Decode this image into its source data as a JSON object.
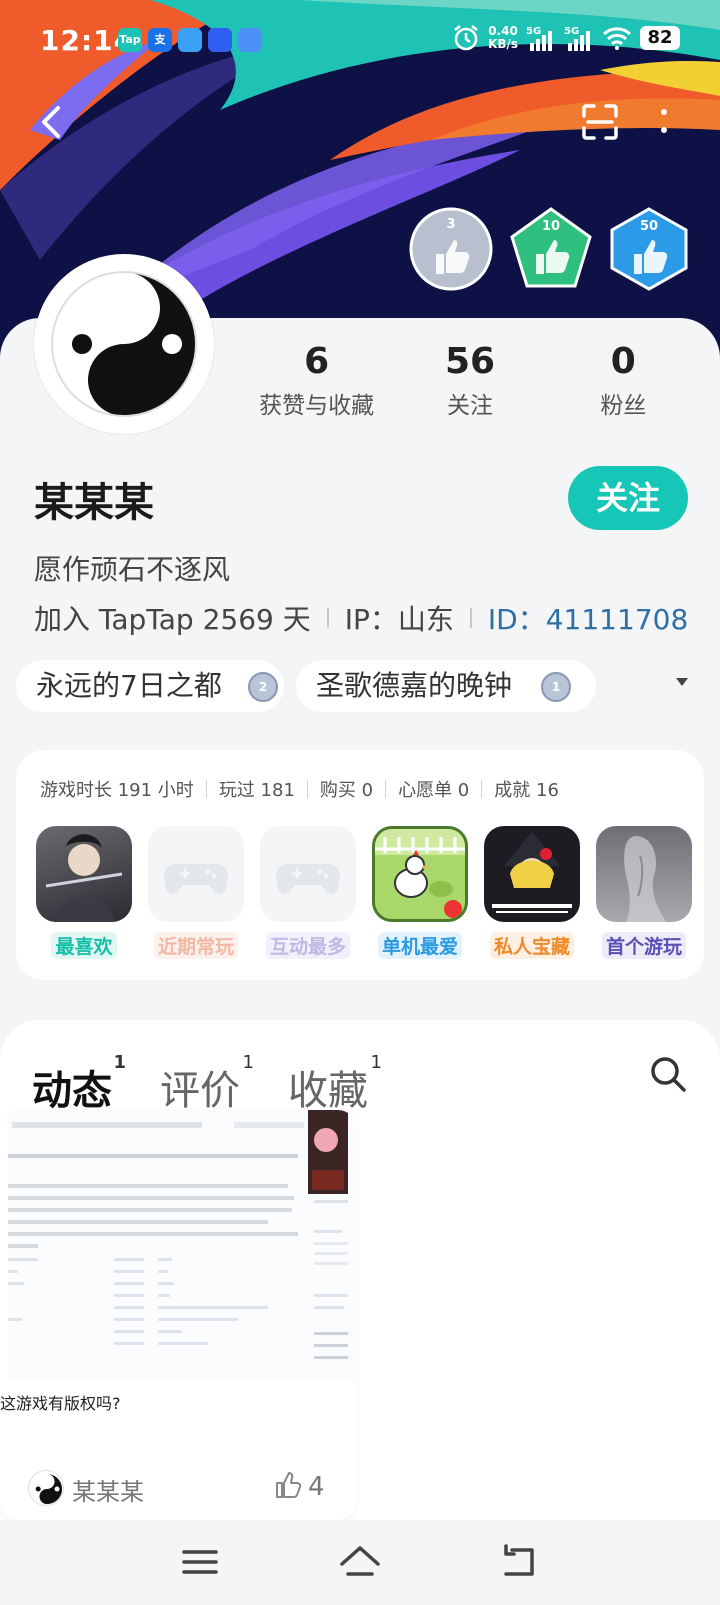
{
  "status_bar": {
    "time": "12:14",
    "net_speed_value": "0.40",
    "net_speed_unit": "KB/s",
    "sim1": "5G",
    "sim2": "5G",
    "battery": "82",
    "apps": [
      "Tap",
      "支",
      "",
      "",
      ""
    ]
  },
  "header": {
    "back_icon": "back-arrow-icon",
    "scan_icon": "scan-icon",
    "more_icon": "more-vertical-icon"
  },
  "badges": [
    {
      "count": "3",
      "color": "#b8bfcf"
    },
    {
      "count": "10",
      "color": "#2fbf7f"
    },
    {
      "count": "50",
      "color": "#2b9be8"
    }
  ],
  "profile": {
    "stats": [
      {
        "value": "6",
        "label": "获赞与收藏"
      },
      {
        "value": "56",
        "label": "关注"
      },
      {
        "value": "0",
        "label": "粉丝"
      }
    ],
    "username": "某某某",
    "follow_label": "关注",
    "bio": "愿作顽石不逐风",
    "joined": "加入 TapTap 2569 天",
    "ip": "IP：山东",
    "id": "ID：41111708"
  },
  "tags": [
    {
      "name": "永远的7日之都",
      "level": "2"
    },
    {
      "name": "圣歌德嘉的晚钟",
      "level": "1"
    }
  ],
  "game_stats": {
    "playtime": "游戏时长 191 小时",
    "played": "玩过 181",
    "bought": "购买 0",
    "wishlist": "心愿单 0",
    "achievements": "成就 16"
  },
  "games": [
    {
      "label": "最喜欢",
      "color": "#16bfa8",
      "bg": "#e0f7f4"
    },
    {
      "label": "近期常玩",
      "color": "#f2b8a4",
      "bg": "#fdf1ed"
    },
    {
      "label": "互动最多",
      "color": "#c2b8e6",
      "bg": "#f3f0fb"
    },
    {
      "label": "单机最爱",
      "color": "#2a9be0",
      "bg": "#e3f2fc"
    },
    {
      "label": "私人宝藏",
      "color": "#f08a2a",
      "bg": "#fdf0e2"
    },
    {
      "label": "首个游玩",
      "color": "#5b4fb3",
      "bg": "#ecebf8"
    }
  ],
  "tabs": [
    {
      "label": "动态",
      "count": "1"
    },
    {
      "label": "评价",
      "count": "1"
    },
    {
      "label": "收藏",
      "count": "1"
    }
  ],
  "post": {
    "title": "这游戏有版权吗?",
    "author": "某某某",
    "likes": "4"
  },
  "colors": {
    "accent": "#16c6b7",
    "id_link": "#2e6fa6"
  }
}
